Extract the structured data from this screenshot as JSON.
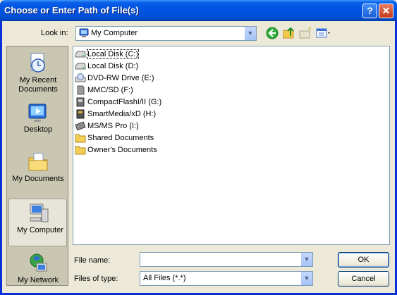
{
  "window": {
    "title": "Choose or Enter Path of File(s)",
    "help_glyph": "?",
    "close_glyph": "✕"
  },
  "toolbar": {
    "look_in_label": "Look in:",
    "look_in_value": "My Computer",
    "look_in_icon": "my-computer-icon",
    "tools": [
      "back-icon",
      "up-folder-icon",
      "new-folder-icon",
      "views-menu-icon"
    ]
  },
  "places": [
    {
      "label": "My Recent Documents",
      "icon": "recent-documents-icon"
    },
    {
      "label": "Desktop",
      "icon": "desktop-icon"
    },
    {
      "label": "My Documents",
      "icon": "my-documents-icon"
    },
    {
      "label": "My Computer",
      "icon": "my-computer-icon",
      "selected": true
    },
    {
      "label": "My Network",
      "icon": "my-network-icon"
    }
  ],
  "files": [
    {
      "label": "Local Disk (C:)",
      "icon": "hard-disk-icon",
      "selected": true
    },
    {
      "label": "Local Disk (D:)",
      "icon": "hard-disk-icon"
    },
    {
      "label": "DVD-RW Drive (E:)",
      "icon": "dvd-drive-icon"
    },
    {
      "label": "MMC/SD (F:)",
      "icon": "memory-card-icon"
    },
    {
      "label": "CompactFlashI/II (G:)",
      "icon": "memory-card-icon"
    },
    {
      "label": "SmartMedia/xD (H:)",
      "icon": "memory-card-icon"
    },
    {
      "label": "MS/MS Pro (I:)",
      "icon": "memory-card-icon"
    },
    {
      "label": "Shared Documents",
      "icon": "folder-icon"
    },
    {
      "label": "Owner's Documents",
      "icon": "folder-icon"
    }
  ],
  "form": {
    "file_name_label": "File name:",
    "file_name_value": "",
    "files_of_type_label": "Files of type:",
    "files_of_type_value": "All Files (*.*)"
  },
  "buttons": {
    "ok": "OK",
    "cancel": "Cancel"
  },
  "colors": {
    "titlebar": "#0054e3",
    "dialog_bg": "#ece9d8",
    "places_bg": "#c9c6b2",
    "field_border": "#7f9db9"
  }
}
